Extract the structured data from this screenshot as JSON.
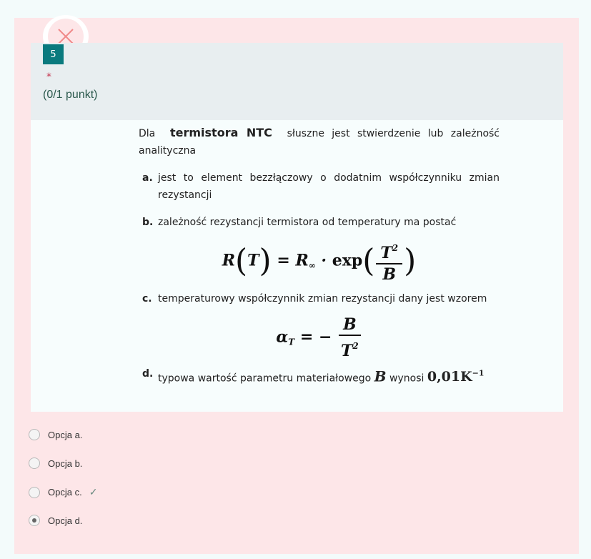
{
  "question": {
    "number": "5",
    "required_mark": "*",
    "points": "(0/1 punkt)",
    "intro_prefix": "Dla",
    "intro_bold": "termistora NTC",
    "intro_suffix": "słuszne jest stwierdzenie lub zależność analityczna",
    "items": [
      {
        "letter": "a.",
        "text": "jest to element bezzłączowy o dodatnim współczynniku zmian rezystancji"
      },
      {
        "letter": "b.",
        "text": "zależność rezystancji termistora od temperatury ma postać"
      },
      {
        "letter": "c.",
        "text": "temperaturowy współczynnik zmian rezystancji dany jest wzorem"
      },
      {
        "letter": "d.",
        "text": "typowa wartość parametru materiałowego",
        "param": "B",
        "tail": "wynosi",
        "value": "0,01K",
        "exp": "−1"
      }
    ]
  },
  "options": [
    {
      "label": "Opcja a.",
      "selected": false,
      "correct": false
    },
    {
      "label": "Opcja b.",
      "selected": false,
      "correct": false
    },
    {
      "label": "Opcja c.",
      "selected": false,
      "correct": true
    },
    {
      "label": "Opcja d.",
      "selected": true,
      "correct": false
    }
  ],
  "icons": {
    "close": "close-icon",
    "correct": "checkmark-icon"
  },
  "colors": {
    "card_bg": "#fde6e8",
    "badge": "#0a7a7e",
    "close_x": "#f08a8a",
    "required": "#c4314b"
  }
}
